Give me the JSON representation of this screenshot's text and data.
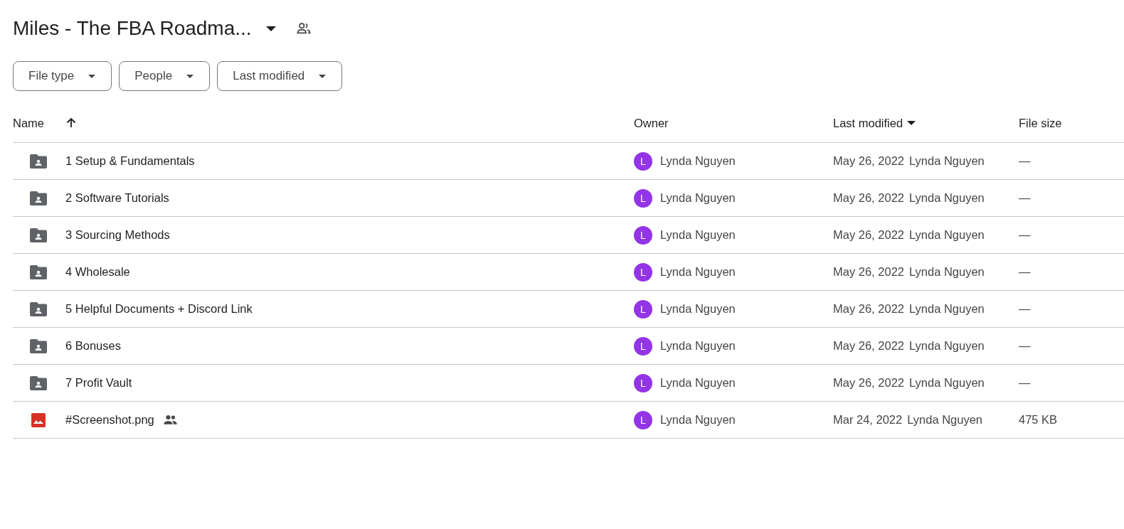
{
  "title": "Miles - The FBA Roadma...",
  "filters": [
    {
      "label": "File type"
    },
    {
      "label": "People"
    },
    {
      "label": "Last modified"
    }
  ],
  "columns": [
    {
      "label": "Name",
      "kind": "sort-asc"
    },
    {
      "label": "Owner",
      "kind": "plain"
    },
    {
      "label": "Last modified",
      "kind": "menu"
    },
    {
      "label": "File size",
      "kind": "plain"
    }
  ],
  "rows": [
    {
      "kind": "folder",
      "name": "1 Setup & Fundamentals",
      "shared": false,
      "owner_initial": "L",
      "owner": "Lynda Nguyen",
      "modified": "May 26, 2022",
      "modified_by": "Lynda Nguyen",
      "size": "—"
    },
    {
      "kind": "folder",
      "name": "2 Software Tutorials",
      "shared": false,
      "owner_initial": "L",
      "owner": "Lynda Nguyen",
      "modified": "May 26, 2022",
      "modified_by": "Lynda Nguyen",
      "size": "—"
    },
    {
      "kind": "folder",
      "name": "3 Sourcing Methods",
      "shared": false,
      "owner_initial": "L",
      "owner": "Lynda Nguyen",
      "modified": "May 26, 2022",
      "modified_by": "Lynda Nguyen",
      "size": "—"
    },
    {
      "kind": "folder",
      "name": "4 Wholesale",
      "shared": false,
      "owner_initial": "L",
      "owner": "Lynda Nguyen",
      "modified": "May 26, 2022",
      "modified_by": "Lynda Nguyen",
      "size": "—"
    },
    {
      "kind": "folder",
      "name": "5 Helpful Documents + Discord Link",
      "shared": false,
      "owner_initial": "L",
      "owner": "Lynda Nguyen",
      "modified": "May 26, 2022",
      "modified_by": "Lynda Nguyen",
      "size": "—"
    },
    {
      "kind": "folder",
      "name": "6 Bonuses",
      "shared": false,
      "owner_initial": "L",
      "owner": "Lynda Nguyen",
      "modified": "May 26, 2022",
      "modified_by": "Lynda Nguyen",
      "size": "—"
    },
    {
      "kind": "folder",
      "name": "7 Profit Vault",
      "shared": false,
      "owner_initial": "L",
      "owner": "Lynda Nguyen",
      "modified": "May 26, 2022",
      "modified_by": "Lynda Nguyen",
      "size": "—"
    },
    {
      "kind": "image",
      "name": "#Screenshot.png",
      "shared": true,
      "owner_initial": "L",
      "owner": "Lynda Nguyen",
      "modified": "Mar 24, 2022",
      "modified_by": "Lynda Nguyen",
      "size": "475 KB"
    }
  ]
}
